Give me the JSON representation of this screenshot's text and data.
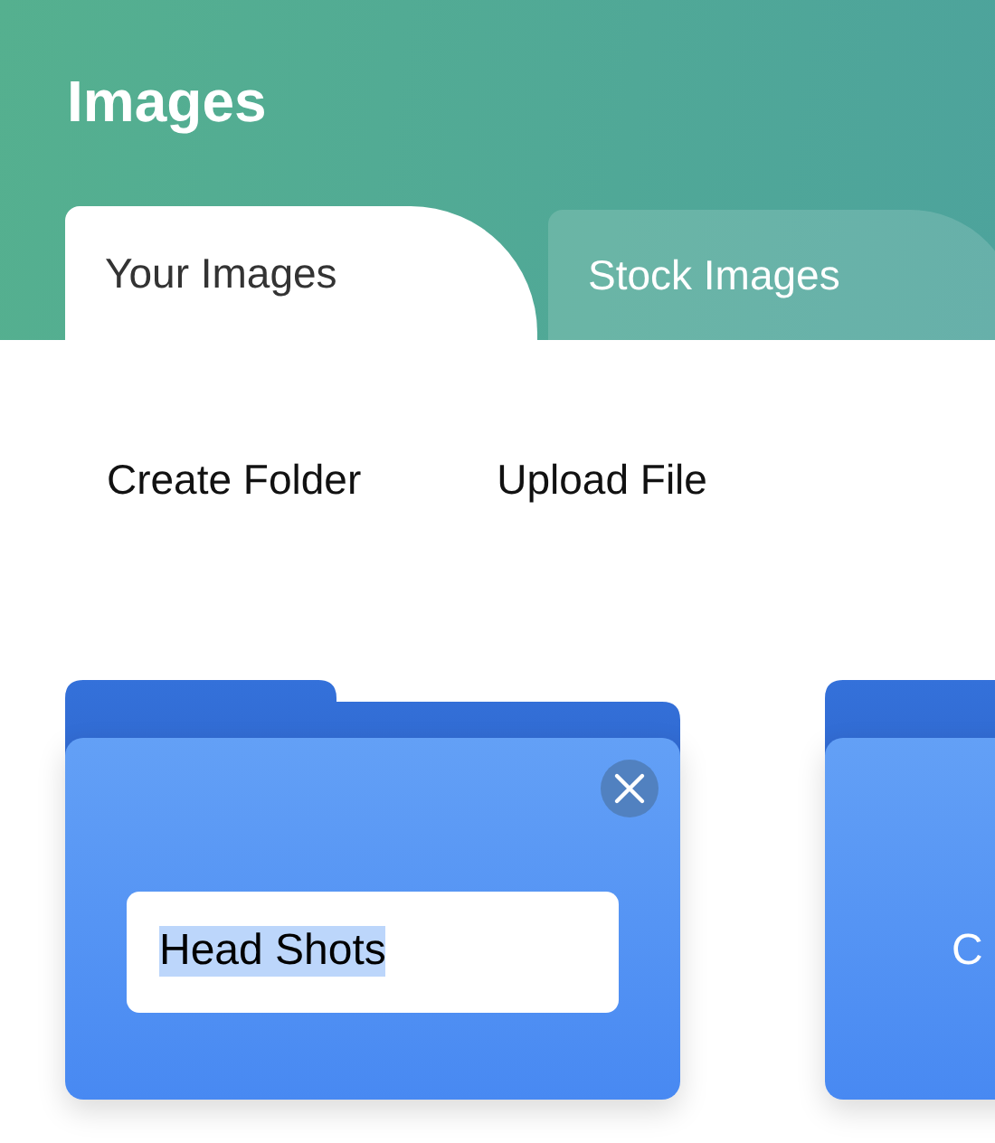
{
  "header": {
    "title": "Images"
  },
  "tabs": [
    {
      "label": "Your Images",
      "selected": true
    },
    {
      "label": "Stock Images",
      "selected": false
    }
  ],
  "actions": [
    "Create Folder",
    "Upload File"
  ],
  "folders": [
    {
      "kind": "editing",
      "value": "Head Shots",
      "text_selected": true
    },
    {
      "kind": "label",
      "name": "C"
    }
  ]
}
